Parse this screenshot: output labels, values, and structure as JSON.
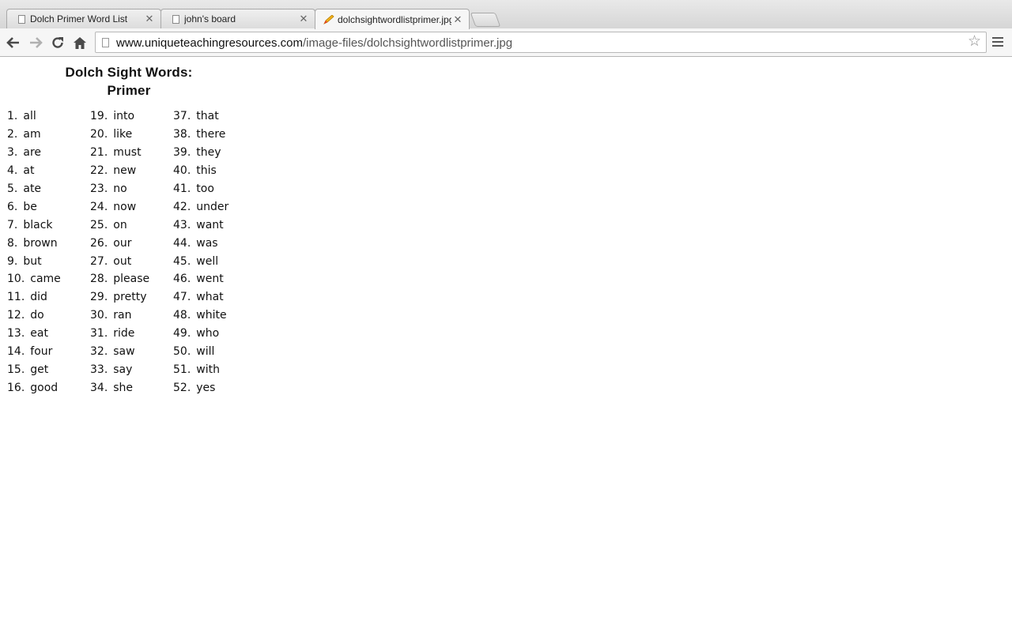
{
  "browser": {
    "tabs": [
      {
        "title": "Dolch Primer Word List",
        "active": false,
        "icon": "page-icon"
      },
      {
        "title": "john's board",
        "active": false,
        "icon": "page-icon"
      },
      {
        "title": "dolchsightwordlistprimer.jpg",
        "active": true,
        "icon": "pencil-icon"
      }
    ],
    "url_domain": "www.uniqueteachingresources.com",
    "url_path": "/image-files/dolchsightwordlistprimer.jpg"
  },
  "document": {
    "title_line1": "Dolch Sight Words:",
    "title_line2": "Primer",
    "columns": [
      [
        {
          "num": "1.",
          "word": "all"
        },
        {
          "num": "2.",
          "word": "am"
        },
        {
          "num": "3.",
          "word": "are"
        },
        {
          "num": "4.",
          "word": "at"
        },
        {
          "num": "5.",
          "word": "ate"
        },
        {
          "num": "6.",
          "word": "be"
        },
        {
          "num": "7.",
          "word": "black"
        },
        {
          "num": "8.",
          "word": "brown"
        },
        {
          "num": "9.",
          "word": "but"
        },
        {
          "num": "10.",
          "word": "came"
        },
        {
          "num": "11.",
          "word": "did"
        },
        {
          "num": "12.",
          "word": "do"
        },
        {
          "num": "13.",
          "word": "eat"
        },
        {
          "num": "14.",
          "word": "four"
        },
        {
          "num": "15.",
          "word": "get"
        },
        {
          "num": "16.",
          "word": "good"
        }
      ],
      [
        {
          "num": "19.",
          "word": "into"
        },
        {
          "num": "20.",
          "word": "like"
        },
        {
          "num": "21.",
          "word": "must"
        },
        {
          "num": "22.",
          "word": "new"
        },
        {
          "num": "23.",
          "word": "no"
        },
        {
          "num": "24.",
          "word": "now"
        },
        {
          "num": "25.",
          "word": "on"
        },
        {
          "num": "26.",
          "word": "our"
        },
        {
          "num": "27.",
          "word": "out"
        },
        {
          "num": "28.",
          "word": "please"
        },
        {
          "num": "29.",
          "word": "pretty"
        },
        {
          "num": "30.",
          "word": "ran"
        },
        {
          "num": "31.",
          "word": "ride"
        },
        {
          "num": "32.",
          "word": "saw"
        },
        {
          "num": "33.",
          "word": "say"
        },
        {
          "num": "34.",
          "word": "she"
        }
      ],
      [
        {
          "num": "37.",
          "word": "that"
        },
        {
          "num": "38.",
          "word": "there"
        },
        {
          "num": "39.",
          "word": "they"
        },
        {
          "num": "40.",
          "word": "this"
        },
        {
          "num": "41.",
          "word": "too"
        },
        {
          "num": "42.",
          "word": "under"
        },
        {
          "num": "43.",
          "word": "want"
        },
        {
          "num": "44.",
          "word": "was"
        },
        {
          "num": "45.",
          "word": "well"
        },
        {
          "num": "46.",
          "word": "went"
        },
        {
          "num": "47.",
          "word": "what"
        },
        {
          "num": "48.",
          "word": "white"
        },
        {
          "num": "49.",
          "word": "who"
        },
        {
          "num": "50.",
          "word": "will"
        },
        {
          "num": "51.",
          "word": "with"
        },
        {
          "num": "52.",
          "word": "yes"
        }
      ]
    ]
  }
}
